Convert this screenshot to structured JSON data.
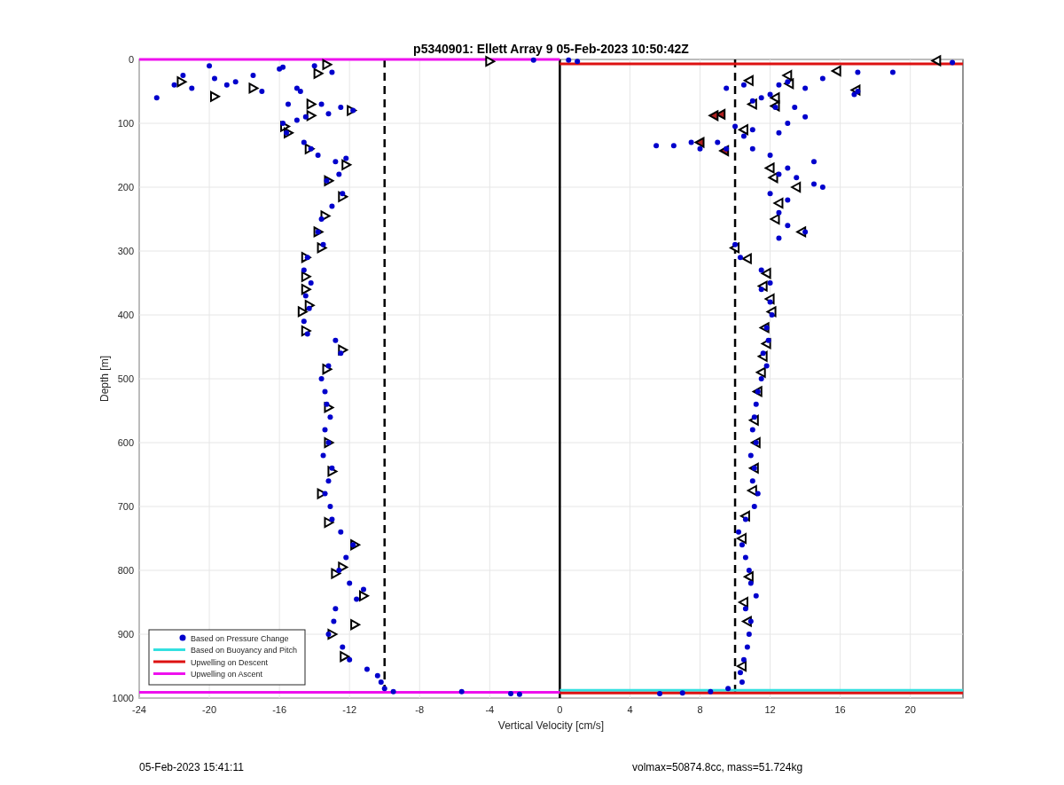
{
  "figure": {
    "chart_data": {
      "type": "scatter",
      "title": "p5340901: Ellett Array 9 05-Feb-2023 10:50:42Z",
      "xlabel": "Vertical Velocity [cm/s]",
      "ylabel": "Depth [m]",
      "xlim": [
        -24,
        23
      ],
      "ylim": [
        1000,
        0
      ],
      "xticks": [
        -24,
        -20,
        -16,
        -12,
        -8,
        -4,
        0,
        4,
        8,
        12,
        16,
        20
      ],
      "yticks": [
        0,
        100,
        200,
        300,
        400,
        500,
        600,
        700,
        800,
        900,
        1000
      ],
      "series": [
        {
          "name": "Based on Pressure Change",
          "color": "#0000cc",
          "marker": "circle",
          "x": [
            -23,
            -22,
            -21.5,
            -21,
            -20,
            -19.7,
            -19,
            -18.5,
            -17.5,
            -17,
            -16,
            -15.8,
            -15.5,
            -15,
            -14.8,
            -14,
            -13.6,
            -13,
            -12.5,
            -11.8,
            -14.5,
            -13.2,
            -15.8,
            -15.6,
            -15,
            -14.6,
            -14.2,
            -13.8,
            -12.8,
            -12.2,
            -12.6,
            -13.3,
            -12.4,
            -13,
            -13.6,
            -13.8,
            -13.5,
            -14.4,
            -14.6,
            -14.2,
            -14.5,
            -14.3,
            -14.6,
            -14.4,
            -12.8,
            -12.5,
            -13.2,
            -13.6,
            -13.4,
            -13.3,
            -13.1,
            -13.4,
            -13.2,
            -13.5,
            -13,
            -13.2,
            -13.4,
            -13.1,
            -13,
            -12.5,
            -11.8,
            -12.2,
            -12.6,
            -12,
            -11.2,
            -11.6,
            -12.8,
            -12.9,
            -13.2,
            -12.4,
            -12,
            -11,
            -10.4,
            -10.2,
            -10,
            -9.5,
            -5.6,
            -2.8,
            -2.3,
            -1.5,
            0.5,
            1,
            22.4,
            19,
            17,
            15,
            13,
            12.5,
            17,
            16.8,
            14,
            12,
            11,
            10.5,
            9.5,
            11.5,
            12.3,
            13.4,
            14,
            13,
            12.5,
            11,
            10.5,
            9,
            7.5,
            6.5,
            5.5,
            8,
            9.5,
            10,
            11,
            12,
            14.5,
            13,
            12.5,
            13.5,
            14.5,
            15,
            12,
            13,
            12.5,
            13,
            14,
            12.5,
            10,
            10.3,
            11.5,
            12,
            11.5,
            12,
            12.1,
            11.8,
            11.9,
            11.6,
            11.8,
            11.5,
            11.3,
            11.2,
            11.1,
            11,
            11.2,
            10.9,
            11.1,
            11,
            11.3,
            11.1,
            10.6,
            10.2,
            10.4,
            10.6,
            10.8,
            10.9,
            11.2,
            10.6,
            10.9,
            10.8,
            10.7,
            10.5,
            10.3,
            10.4,
            9.6,
            8.6,
            7,
            5.7
          ],
          "values": [
            60,
            40,
            25,
            45,
            10,
            30,
            40,
            35,
            25,
            50,
            15,
            12,
            70,
            45,
            50,
            10,
            70,
            20,
            75,
            80,
            90,
            85,
            100,
            115,
            95,
            130,
            140,
            150,
            160,
            155,
            180,
            190,
            210,
            230,
            250,
            270,
            290,
            310,
            330,
            350,
            370,
            390,
            410,
            430,
            440,
            460,
            480,
            500,
            520,
            540,
            560,
            580,
            600,
            620,
            640,
            660,
            680,
            700,
            720,
            740,
            760,
            780,
            800,
            820,
            830,
            845,
            860,
            880,
            900,
            920,
            940,
            955,
            965,
            975,
            985,
            990,
            990,
            993,
            994,
            1,
            1,
            3,
            5,
            20,
            20,
            30,
            35,
            40,
            50,
            55,
            45,
            55,
            65,
            40,
            45,
            60,
            75,
            75,
            90,
            100,
            115,
            110,
            120,
            130,
            130,
            135,
            135,
            140,
            140,
            105,
            140,
            150,
            160,
            170,
            180,
            185,
            195,
            200,
            210,
            220,
            240,
            260,
            270,
            280,
            290,
            310,
            330,
            350,
            360,
            380,
            400,
            420,
            440,
            460,
            480,
            500,
            520,
            540,
            560,
            580,
            600,
            620,
            640,
            660,
            680,
            700,
            720,
            740,
            760,
            780,
            800,
            820,
            840,
            860,
            880,
            900,
            920,
            940,
            960,
            975,
            985,
            990,
            992,
            993
          ]
        },
        {
          "name": "Based on Buoyancy and Pitch",
          "color": "#33e0e0",
          "type": "line",
          "x": [
            0,
            23
          ],
          "values": [
            988,
            988
          ]
        },
        {
          "name": "Upwelling on Descent",
          "color": "#dd1111",
          "type": "line",
          "x": [
            0,
            23
          ],
          "values": [
            7,
            7
          ]
        },
        {
          "color": "#dd1111",
          "type": "line",
          "x": [
            0,
            23
          ],
          "values": [
            992,
            992
          ]
        },
        {
          "name": "Upwelling on Ascent",
          "color": "#ee11ee",
          "type": "line",
          "x": [
            -24,
            0
          ],
          "values": [
            0,
            0
          ]
        },
        {
          "color": "#ee11ee",
          "type": "line",
          "x": [
            -24,
            0
          ],
          "values": [
            991,
            991
          ]
        },
        {
          "color": "#ffffff",
          "marker": "triangle",
          "x": [
            -21.6,
            -19.7,
            -17.5,
            -13.3,
            -13.8,
            -14.2,
            -14.2,
            -11.9,
            -15.7,
            -15.5,
            -14.3,
            -12.2,
            -13.2,
            -12.4,
            -13.4,
            -13.8,
            -13.6,
            -14.5,
            -14.5,
            -14.5,
            -14.3,
            -14.7,
            -14.5,
            -12.4,
            -13.3,
            -13.2,
            -13.2,
            -13,
            -13.6,
            -13.2,
            -11.7,
            -12.4,
            -12.8,
            -11.2,
            -11.7,
            -13,
            -12.3,
            -4
          ],
          "values": [
            35,
            58,
            45,
            8,
            22,
            70,
            88,
            80,
            105,
            115,
            140,
            165,
            190,
            215,
            245,
            270,
            295,
            310,
            340,
            360,
            385,
            395,
            425,
            455,
            485,
            545,
            600,
            645,
            680,
            725,
            760,
            795,
            805,
            840,
            885,
            900,
            935,
            3
          ]
        },
        {
          "color": "#ffffff",
          "marker": "triangle",
          "x": [
            21.5,
            15.8,
            13,
            13.1,
            10.8,
            12.3,
            12.3,
            11,
            16.9,
            10.5,
            12,
            12.2,
            13.5,
            12.5,
            12.3,
            13.8,
            10,
            10.7,
            11.8,
            11.6,
            12,
            12.1,
            11.7,
            11.8,
            11.6,
            11.5,
            11.3,
            11.1,
            11.2,
            11.1,
            11,
            10.6,
            10.4,
            10.8,
            10.5,
            10.7,
            10.4
          ],
          "values": [
            2,
            18,
            25,
            38,
            33,
            60,
            73,
            70,
            48,
            110,
            170,
            185,
            200,
            225,
            250,
            270,
            295,
            312,
            335,
            355,
            375,
            395,
            420,
            445,
            465,
            490,
            520,
            565,
            600,
            640,
            675,
            715,
            750,
            810,
            850,
            880,
            950
          ]
        },
        {
          "color": "#b02020",
          "marker": "triangle",
          "x": [
            9.2,
            8,
            9.4,
            8.8
          ],
          "values": [
            86,
            130,
            143,
            88
          ]
        }
      ],
      "ref_lines": [
        {
          "axis": "x",
          "value": -10
        },
        {
          "axis": "x",
          "value": 10
        }
      ],
      "grid": true,
      "legend": "lower left"
    }
  },
  "footer": {
    "timestamp": "05-Feb-2023 15:41:11",
    "summary": "volmax=50874.8cc, mass=51.724kg"
  }
}
